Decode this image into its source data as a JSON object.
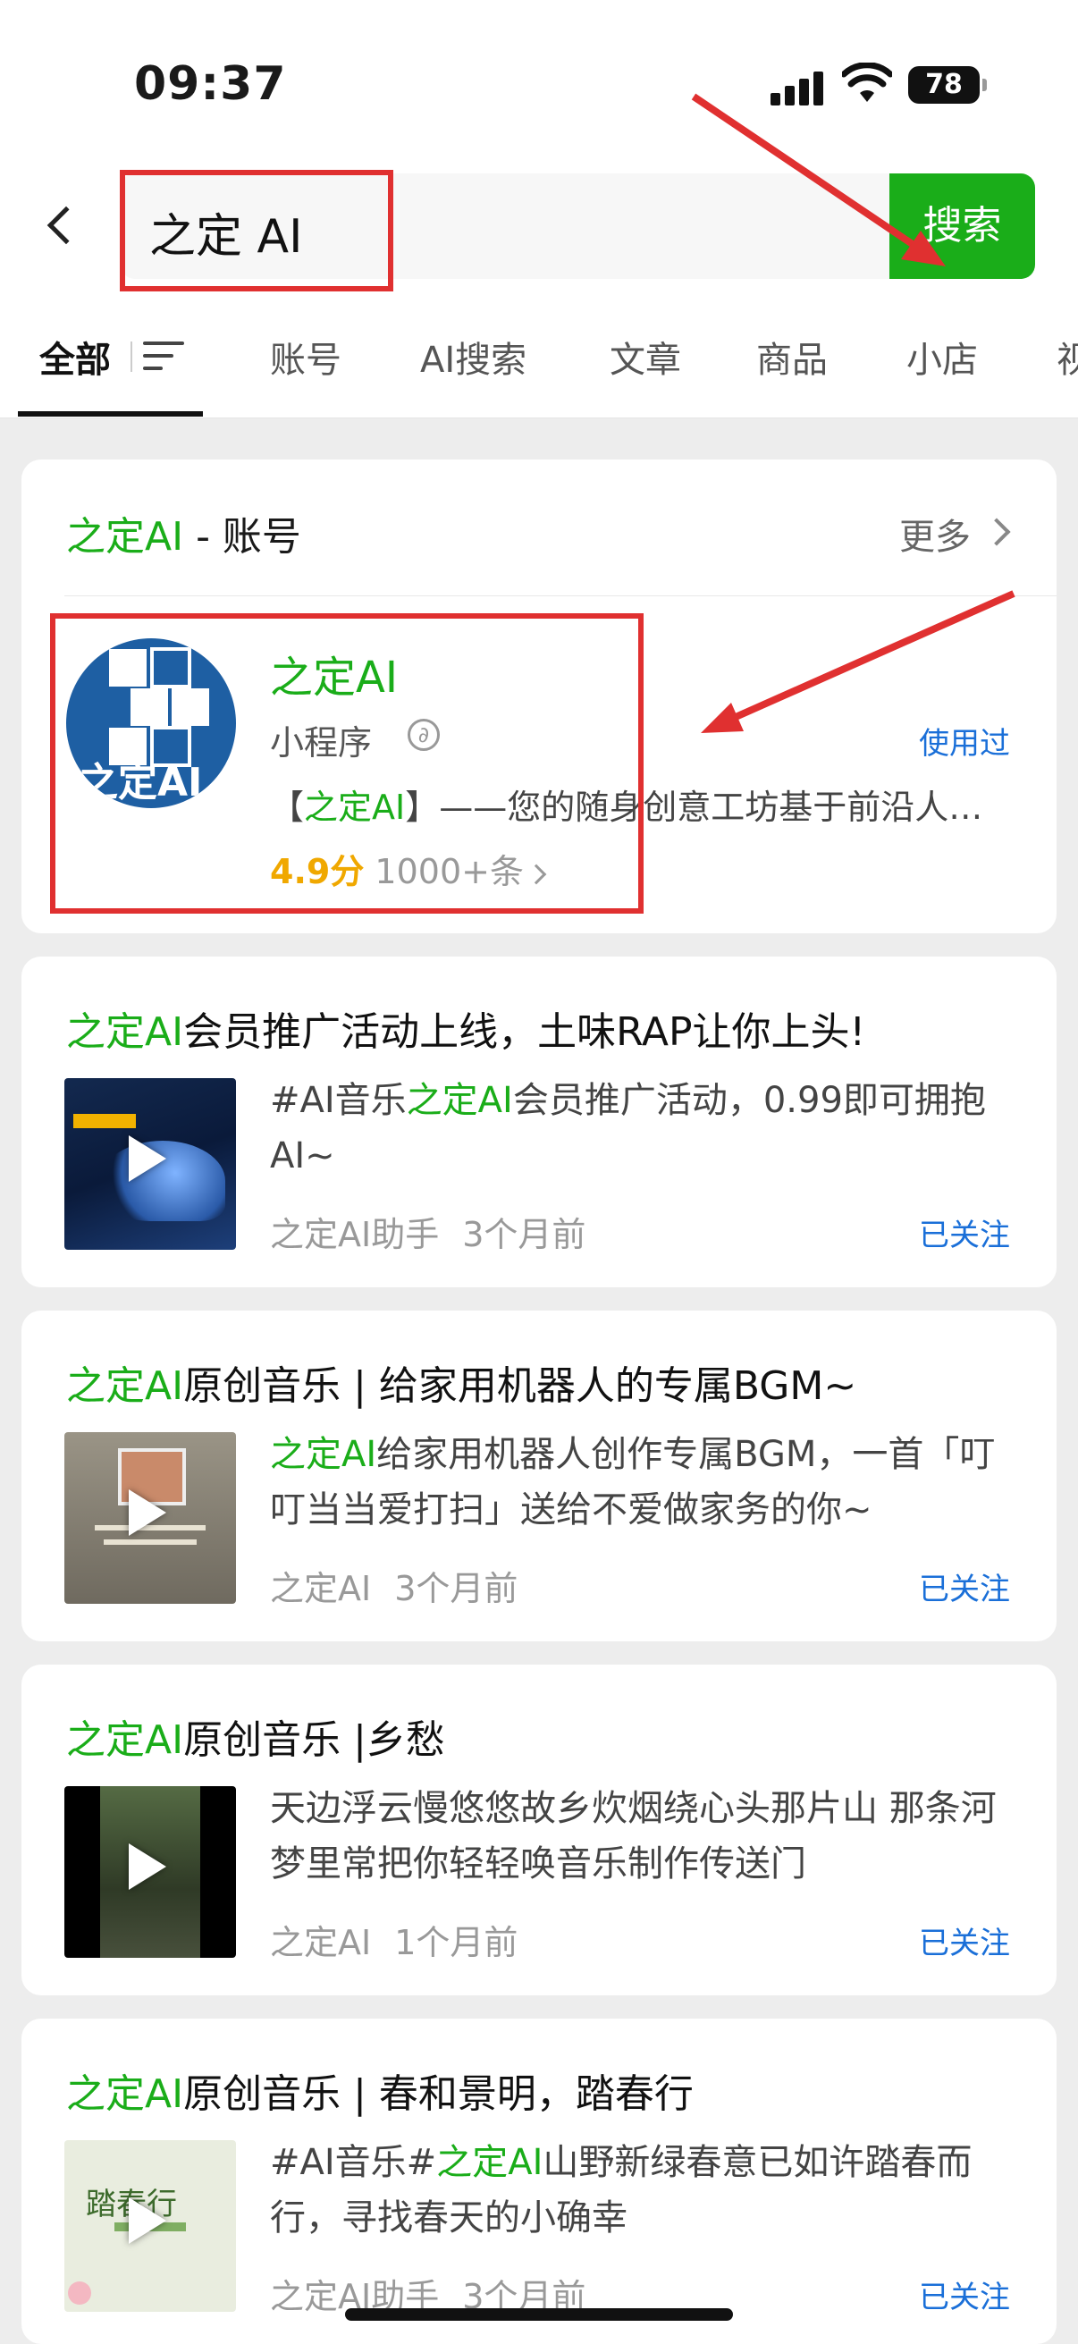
{
  "status": {
    "time": "09:37",
    "battery": "78"
  },
  "search": {
    "query": "之定 AI",
    "clear_glyph": "×",
    "button_label": "搜索"
  },
  "tabs": [
    "全部",
    "账号",
    "AI搜索",
    "文章",
    "商品",
    "小店",
    "视"
  ],
  "account_section": {
    "header_brand": "之定AI",
    "header_suffix": " - 账号",
    "more_label": "更多",
    "name": "之定AI",
    "type": "小程序",
    "link_glyph": "∂",
    "used_label": "使用过",
    "desc_prefix": "【",
    "desc_brand": "之定AI",
    "desc_rest": "】——您的随身创意工坊基于前沿人…",
    "score": "4.9分",
    "reviews": "1000+条",
    "logo_text": "之定AI"
  },
  "articles": [
    {
      "title_brand": "之定AI",
      "title_rest": "会员推广活动上线，土味RAP让你上头!",
      "desc_parts": [
        "#AI音乐",
        "之定AI",
        "会员推广活动，0.99即可拥抱AI~"
      ],
      "author": "之定AI助手",
      "time": "3个月前",
      "status": "已关注",
      "thumb_color": "#0a1a3a"
    },
    {
      "title_brand": "之定AI",
      "title_rest": "原创音乐 | 给家用机器人的专属BGM~",
      "desc_parts": [
        "",
        "之定AI",
        "给家用机器人创作专属BGM，一首「叮叮当当爱打扫」送给不爱做家务的你~"
      ],
      "author": "之定AI",
      "time": "3个月前",
      "status": "已关注",
      "thumb_color": "#8a8578"
    },
    {
      "title_brand": "之定AI",
      "title_rest": "原创音乐 |乡愁",
      "desc_parts": [
        "天边浮云慢悠悠故乡炊烟绕心头那片山 那条河梦里常把你轻轻唤音乐制作传送门",
        "",
        ""
      ],
      "author": "之定AI",
      "time": "1个月前",
      "status": "已关注",
      "thumb_color": "#3c4a32"
    },
    {
      "title_brand": "之定AI",
      "title_rest": "原创音乐 | 春和景明，踏春行",
      "desc_parts": [
        "#AI音乐#",
        "之定AI",
        "山野新绿春意已如许踏春而行，寻找春天的小确幸"
      ],
      "author": "之定AI助手",
      "time": "3个月前",
      "status": "已关注",
      "thumb_color": "#e9eddf",
      "thumb_text": "踏春行"
    }
  ],
  "colors": {
    "brand_green": "#1aad19",
    "link_blue": "#1a6fd8",
    "rating_orange": "#f0a800",
    "annotation_red": "#e03030"
  }
}
